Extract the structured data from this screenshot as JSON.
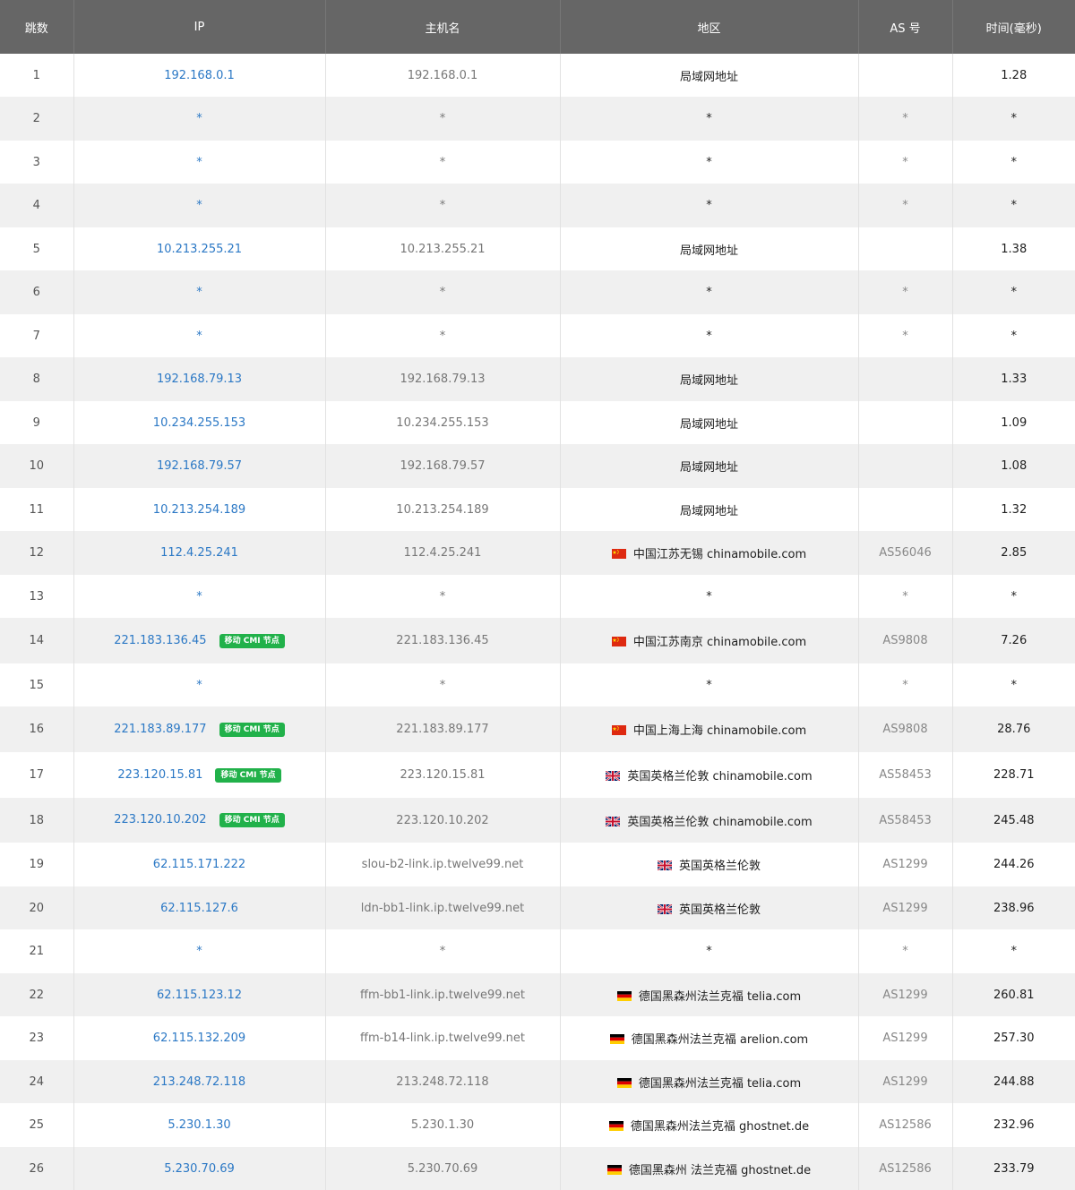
{
  "headers": [
    "跳数",
    "IP",
    "主机名",
    "地区",
    "AS 号",
    "时间(毫秒)"
  ],
  "tag_label": "移动 CMI 节点",
  "rows": [
    {
      "hop": "1",
      "ip": "192.168.0.1",
      "host": "192.168.0.1",
      "flag": "",
      "geo": "局域网地址",
      "as": "",
      "time": "1.28",
      "tag": false,
      "h": 48
    },
    {
      "hop": "2",
      "ip": "*",
      "host": "*",
      "flag": "",
      "geo": "*",
      "as": "*",
      "time": "*",
      "tag": false,
      "h": 49
    },
    {
      "hop": "3",
      "ip": "*",
      "host": "*",
      "flag": "",
      "geo": "*",
      "as": "*",
      "time": "*",
      "tag": false,
      "h": 48
    },
    {
      "hop": "4",
      "ip": "*",
      "host": "*",
      "flag": "",
      "geo": "*",
      "as": "*",
      "time": "*",
      "tag": false,
      "h": 49
    },
    {
      "hop": "5",
      "ip": "10.213.255.21",
      "host": "10.213.255.21",
      "flag": "",
      "geo": "局域网地址",
      "as": "",
      "time": "1.38",
      "tag": false,
      "h": 48
    },
    {
      "hop": "6",
      "ip": "*",
      "host": "*",
      "flag": "",
      "geo": "*",
      "as": "*",
      "time": "*",
      "tag": false,
      "h": 49
    },
    {
      "hop": "7",
      "ip": "*",
      "host": "*",
      "flag": "",
      "geo": "*",
      "as": "*",
      "time": "*",
      "tag": false,
      "h": 48
    },
    {
      "hop": "8",
      "ip": "192.168.79.13",
      "host": "192.168.79.13",
      "flag": "",
      "geo": "局域网地址",
      "as": "",
      "time": "1.33",
      "tag": false,
      "h": 49
    },
    {
      "hop": "9",
      "ip": "10.234.255.153",
      "host": "10.234.255.153",
      "flag": "",
      "geo": "局域网地址",
      "as": "",
      "time": "1.09",
      "tag": false,
      "h": 48
    },
    {
      "hop": "10",
      "ip": "192.168.79.57",
      "host": "192.168.79.57",
      "flag": "",
      "geo": "局域网地址",
      "as": "",
      "time": "1.08",
      "tag": false,
      "h": 49
    },
    {
      "hop": "11",
      "ip": "10.213.254.189",
      "host": "10.213.254.189",
      "flag": "",
      "geo": "局域网地址",
      "as": "",
      "time": "1.32",
      "tag": false,
      "h": 48
    },
    {
      "hop": "12",
      "ip": "112.4.25.241",
      "host": "112.4.25.241",
      "flag": "cn",
      "geo": "中国江苏无锡 chinamobile.com",
      "as": "AS56046",
      "time": "2.85",
      "tag": false,
      "h": 49
    },
    {
      "hop": "13",
      "ip": "*",
      "host": "*",
      "flag": "",
      "geo": "*",
      "as": "*",
      "time": "*",
      "tag": false,
      "h": 48
    },
    {
      "hop": "14",
      "ip": "221.183.136.45",
      "host": "221.183.136.45",
      "flag": "cn",
      "geo": "中国江苏南京 chinamobile.com",
      "as": "AS9808",
      "time": "7.26",
      "tag": true,
      "h": 51
    },
    {
      "hop": "15",
      "ip": "*",
      "host": "*",
      "flag": "",
      "geo": "*",
      "as": "*",
      "time": "*",
      "tag": false,
      "h": 48
    },
    {
      "hop": "16",
      "ip": "221.183.89.177",
      "host": "221.183.89.177",
      "flag": "cn",
      "geo": "中国上海上海 chinamobile.com",
      "as": "AS9808",
      "time": "28.76",
      "tag": true,
      "h": 51
    },
    {
      "hop": "17",
      "ip": "223.120.15.81",
      "host": "223.120.15.81",
      "flag": "gb",
      "geo": "英国英格兰伦敦 chinamobile.com",
      "as": "AS58453",
      "time": "228.71",
      "tag": true,
      "h": 51
    },
    {
      "hop": "18",
      "ip": "223.120.10.202",
      "host": "223.120.10.202",
      "flag": "gb",
      "geo": "英国英格兰伦敦 chinamobile.com",
      "as": "AS58453",
      "time": "245.48",
      "tag": true,
      "h": 50
    },
    {
      "hop": "19",
      "ip": "62.115.171.222",
      "host": "slou-b2-link.ip.twelve99.net",
      "flag": "gb",
      "geo": "英国英格兰伦敦",
      "as": "AS1299",
      "time": "244.26",
      "tag": false,
      "h": 49
    },
    {
      "hop": "20",
      "ip": "62.115.127.6",
      "host": "ldn-bb1-link.ip.twelve99.net",
      "flag": "gb",
      "geo": "英国英格兰伦敦",
      "as": "AS1299",
      "time": "238.96",
      "tag": false,
      "h": 48
    },
    {
      "hop": "21",
      "ip": "*",
      "host": "*",
      "flag": "",
      "geo": "*",
      "as": "*",
      "time": "*",
      "tag": false,
      "h": 49
    },
    {
      "hop": "22",
      "ip": "62.115.123.12",
      "host": "ffm-bb1-link.ip.twelve99.net",
      "flag": "de",
      "geo": "德国黑森州法兰克福 telia.com",
      "as": "AS1299",
      "time": "260.81",
      "tag": false,
      "h": 48
    },
    {
      "hop": "23",
      "ip": "62.115.132.209",
      "host": "ffm-b14-link.ip.twelve99.net",
      "flag": "de",
      "geo": "德国黑森州法兰克福 arelion.com",
      "as": "AS1299",
      "time": "257.30",
      "tag": false,
      "h": 49
    },
    {
      "hop": "24",
      "ip": "213.248.72.118",
      "host": "213.248.72.118",
      "flag": "de",
      "geo": "德国黑森州法兰克福 telia.com",
      "as": "AS1299",
      "time": "244.88",
      "tag": false,
      "h": 48
    },
    {
      "hop": "25",
      "ip": "5.230.1.30",
      "host": "5.230.1.30",
      "flag": "de",
      "geo": "德国黑森州法兰克福 ghostnet.de",
      "as": "AS12586",
      "time": "232.96",
      "tag": false,
      "h": 49
    },
    {
      "hop": "26",
      "ip": "5.230.70.69",
      "host": "5.230.70.69",
      "flag": "de",
      "geo": "德国黑森州 法兰克福 ghostnet.de",
      "as": "AS12586",
      "time": "233.79",
      "tag": false,
      "h": 48
    }
  ]
}
